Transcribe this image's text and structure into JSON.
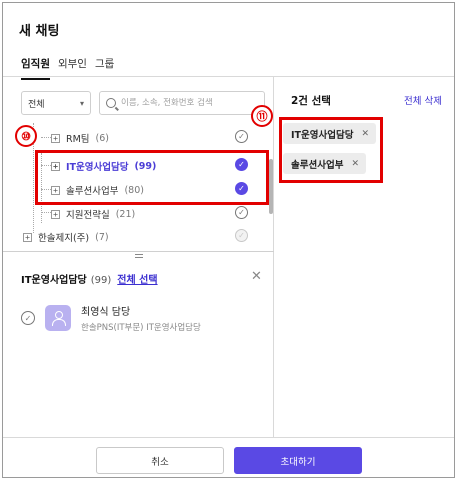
{
  "dialog": {
    "title": "새 채팅"
  },
  "tabs": [
    {
      "label": "임직원",
      "active": true
    },
    {
      "label": "외부인",
      "active": false
    },
    {
      "label": "그룹",
      "active": false
    }
  ],
  "search": {
    "scope_selected": "전체",
    "placeholder": "이름, 소속, 전화번호 검색",
    "value": ""
  },
  "tree": {
    "nodes": [
      {
        "label": "RM팀",
        "count": "(6)",
        "checked": false,
        "highlight": false
      },
      {
        "label": "IT운영사업담당",
        "count": "(99)",
        "checked": true,
        "highlight": true
      },
      {
        "label": "솔루션사업부",
        "count": "(80)",
        "checked": true,
        "highlight": false
      },
      {
        "label": "지원전략실",
        "count": "(21)",
        "checked": false,
        "highlight": false
      },
      {
        "label": "한솔제지(주)",
        "count": "(7)",
        "checked": false,
        "disabled": true,
        "highlight": false
      }
    ]
  },
  "detail": {
    "group_name": "IT운영사업담당",
    "count": "(99)",
    "select_all_label": "전체 선택",
    "close_icon": "close-icon",
    "members": [
      {
        "name": "최영식 담당",
        "org": "한솔PNS(IT부문) IT운영사업담당"
      }
    ]
  },
  "selection": {
    "header": "2건 선택",
    "clear_all_label": "전체 삭제",
    "chips": [
      {
        "label": "IT운영사업담당"
      },
      {
        "label": "솔루션사업부"
      }
    ]
  },
  "annotations": {
    "marker_left": "⑩",
    "marker_right": "⑪",
    "highlight_color": "#e20000"
  },
  "buttons": {
    "cancel_label": "취소",
    "invite_label": "초대하기"
  },
  "colors": {
    "accent": "#5a49e4",
    "link": "#3b2fd0"
  },
  "icons": {
    "check": "✓",
    "plus": "+",
    "remove": "✕"
  }
}
